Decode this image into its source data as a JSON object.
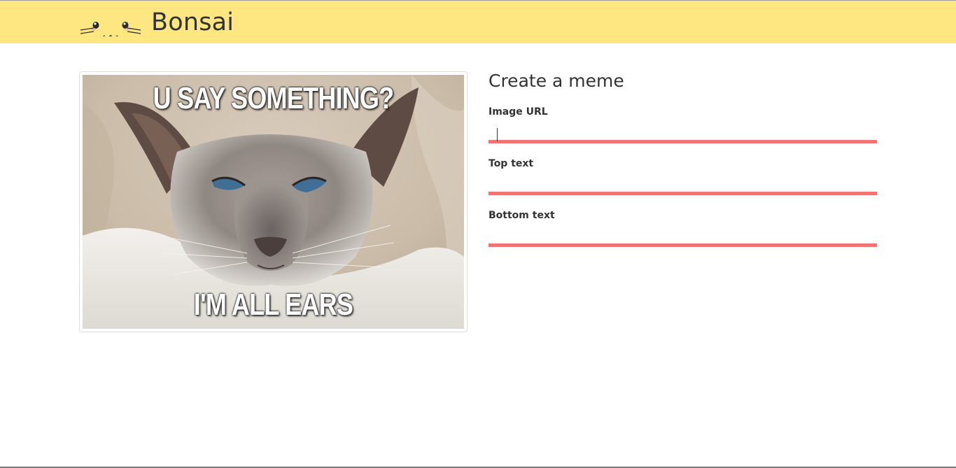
{
  "header": {
    "brand_name": "Bonsai",
    "logo_icon": "cat-face-icon",
    "background_color": "#fee681"
  },
  "meme": {
    "top_text": "U SAY SOMETHING?",
    "bottom_text": "I'M ALL EARS",
    "image_subject": "siamese-cat-photo"
  },
  "form": {
    "title": "Create a meme",
    "fields": [
      {
        "label": "Image URL",
        "value": ""
      },
      {
        "label": "Top text",
        "value": ""
      },
      {
        "label": "Bottom text",
        "value": ""
      }
    ],
    "underline_color": "#f07474"
  }
}
